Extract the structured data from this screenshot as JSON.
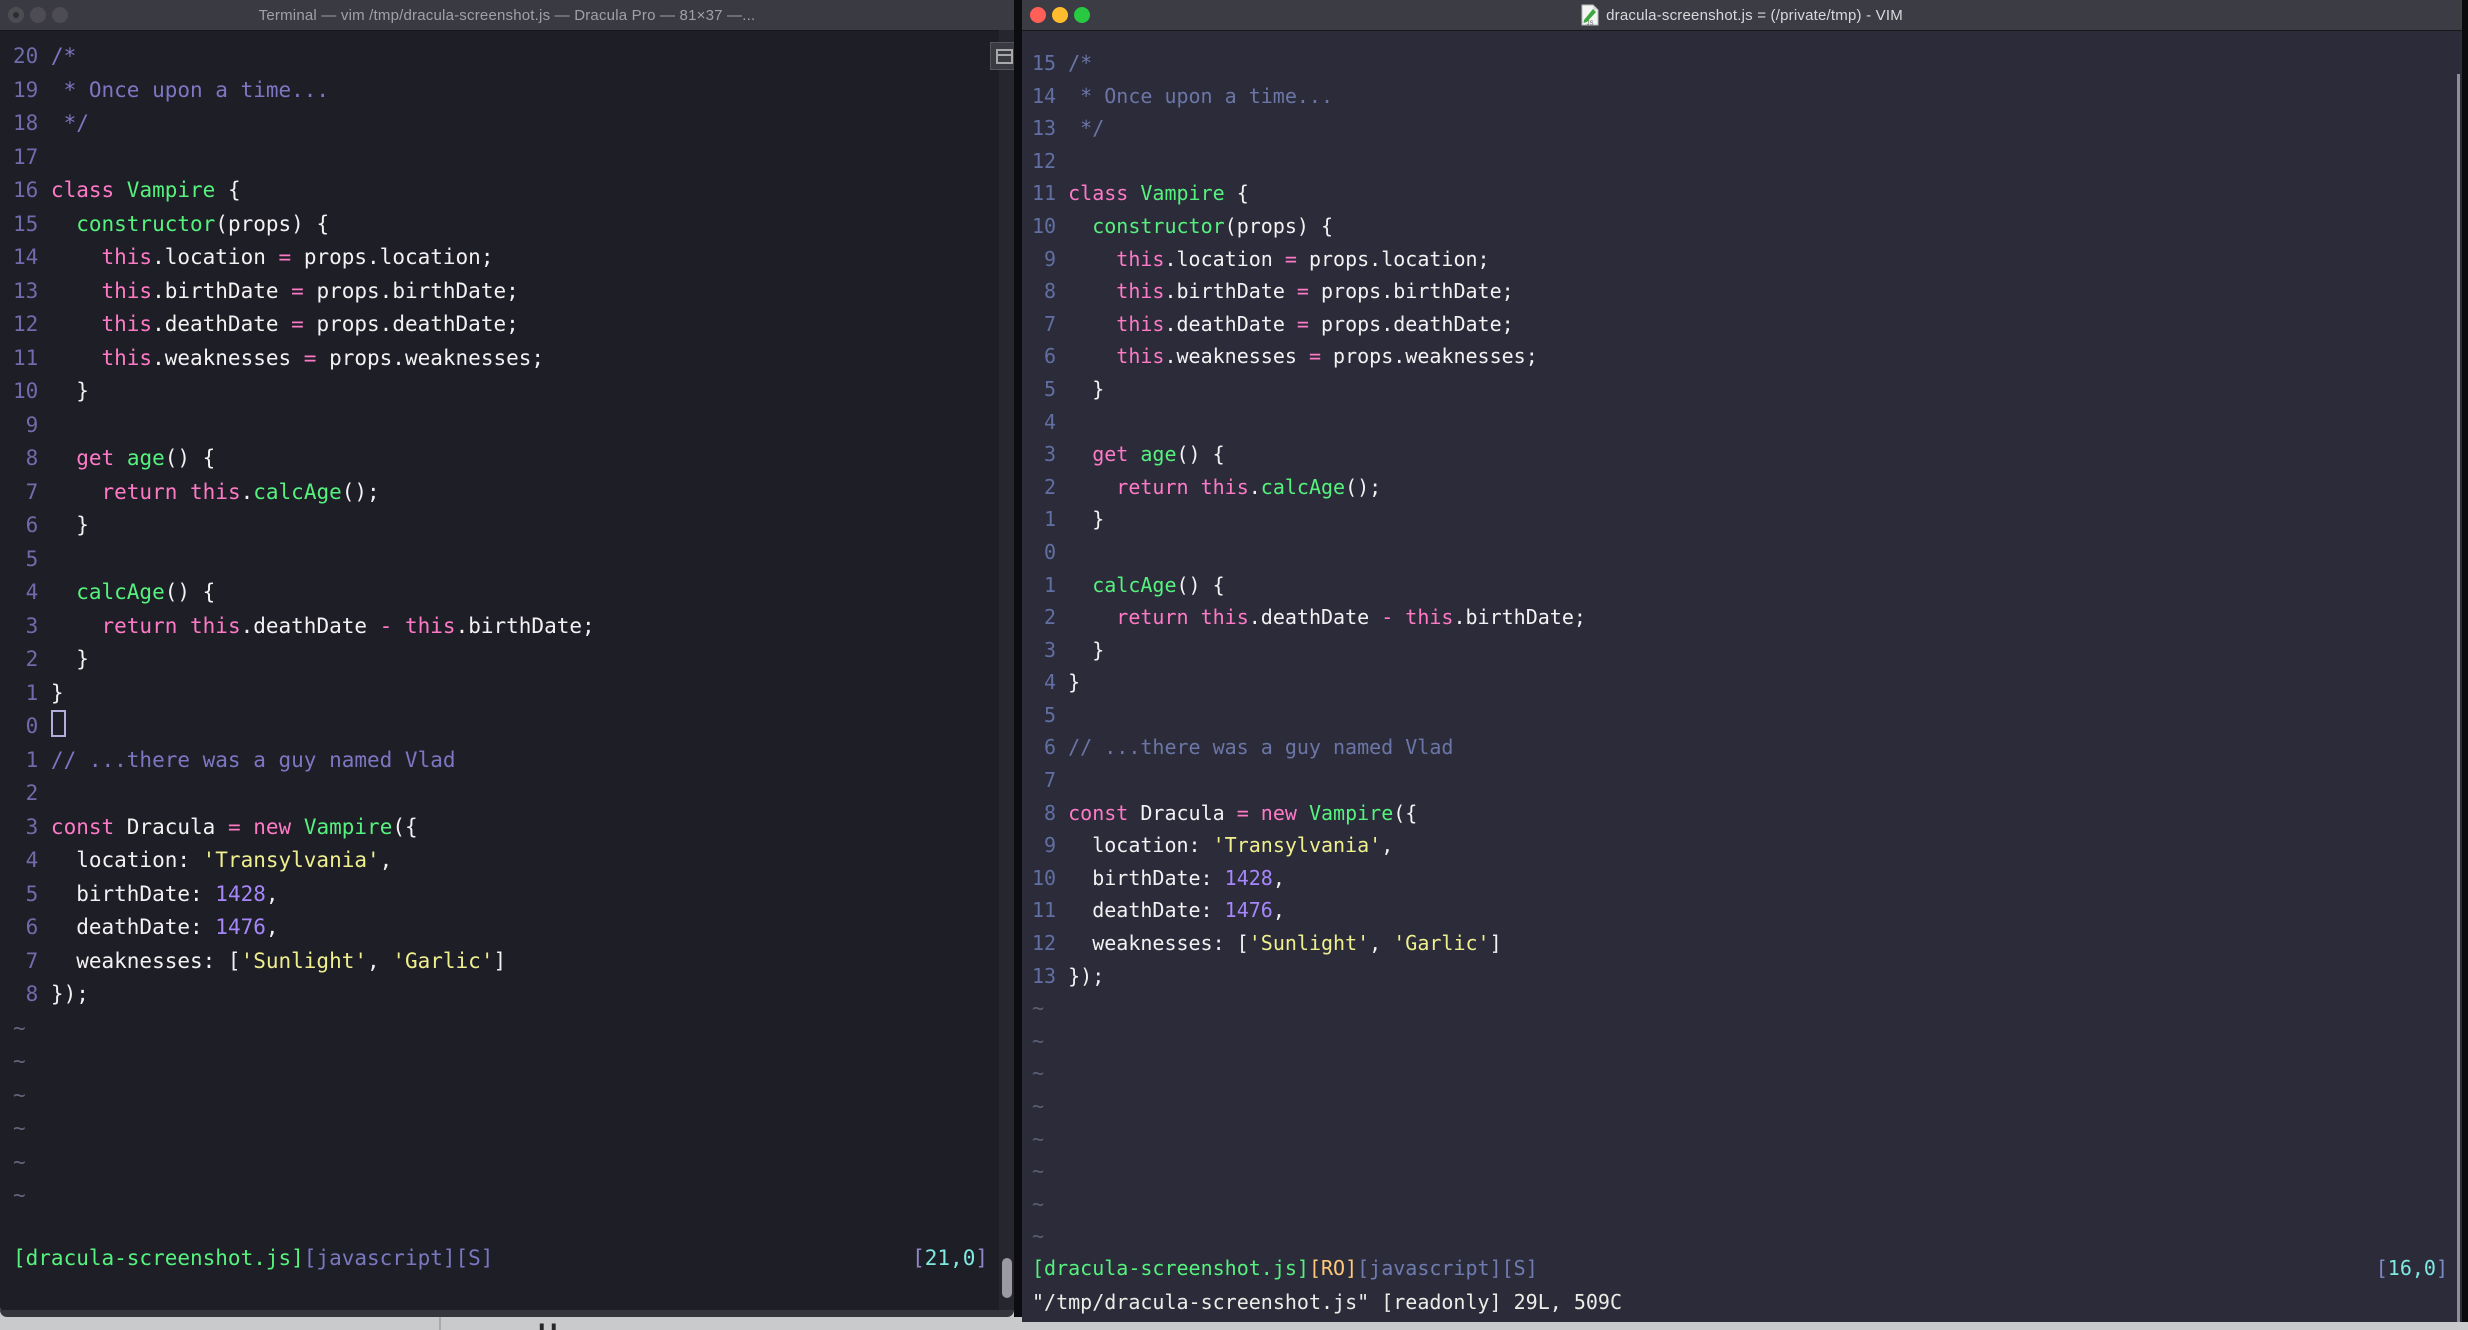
{
  "colors": {
    "left_bg": "#1E1E27",
    "right_bg": "#2B2B3A",
    "titlebar": "#3A3A42",
    "fg": "#F3F1F2",
    "pink": "#FF7AC6",
    "green": "#55F27D",
    "yellow": "#EFF08D",
    "number_literal": "#A687FA",
    "comment_left": "#7E76C2",
    "comment_right": "#6B76A6",
    "lineno_left": "#716BAC",
    "lineno_right": "#626FA2",
    "orange_ro": "#FFC87A",
    "cyan_pos": "#7FE9E2",
    "traffic_red": "#FF5F57",
    "traffic_yellow": "#FEBC2E",
    "traffic_green": "#28C840"
  },
  "file": {
    "lines": [
      [
        [
          "c",
          "/*"
        ]
      ],
      [
        [
          "c",
          " * Once upon a time..."
        ]
      ],
      [
        [
          "c",
          " */"
        ]
      ],
      [
        [
          "w",
          ""
        ]
      ],
      [
        [
          "k",
          "class"
        ],
        [
          "w",
          " "
        ],
        [
          "f",
          "Vampire"
        ],
        [
          "w",
          " {"
        ]
      ],
      [
        [
          "w",
          "  "
        ],
        [
          "f",
          "constructor"
        ],
        [
          "w",
          "(props) {"
        ]
      ],
      [
        [
          "w",
          "    "
        ],
        [
          "k",
          "this"
        ],
        [
          "w",
          ".location "
        ],
        [
          "k",
          "="
        ],
        [
          "w",
          " props.location;"
        ]
      ],
      [
        [
          "w",
          "    "
        ],
        [
          "k",
          "this"
        ],
        [
          "w",
          ".birthDate "
        ],
        [
          "k",
          "="
        ],
        [
          "w",
          " props.birthDate;"
        ]
      ],
      [
        [
          "w",
          "    "
        ],
        [
          "k",
          "this"
        ],
        [
          "w",
          ".deathDate "
        ],
        [
          "k",
          "="
        ],
        [
          "w",
          " props.deathDate;"
        ]
      ],
      [
        [
          "w",
          "    "
        ],
        [
          "k",
          "this"
        ],
        [
          "w",
          ".weaknesses "
        ],
        [
          "k",
          "="
        ],
        [
          "w",
          " props.weaknesses;"
        ]
      ],
      [
        [
          "w",
          "  }"
        ]
      ],
      [
        [
          "w",
          ""
        ]
      ],
      [
        [
          "w",
          "  "
        ],
        [
          "k",
          "get"
        ],
        [
          "w",
          " "
        ],
        [
          "f",
          "age"
        ],
        [
          "w",
          "() {"
        ]
      ],
      [
        [
          "w",
          "    "
        ],
        [
          "k",
          "return"
        ],
        [
          "w",
          " "
        ],
        [
          "k",
          "this"
        ],
        [
          "w",
          "."
        ],
        [
          "f",
          "calcAge"
        ],
        [
          "w",
          "();"
        ]
      ],
      [
        [
          "w",
          "  }"
        ]
      ],
      [
        [
          "w",
          ""
        ]
      ],
      [
        [
          "w",
          "  "
        ],
        [
          "f",
          "calcAge"
        ],
        [
          "w",
          "() {"
        ]
      ],
      [
        [
          "w",
          "    "
        ],
        [
          "k",
          "return"
        ],
        [
          "w",
          " "
        ],
        [
          "k",
          "this"
        ],
        [
          "w",
          ".deathDate "
        ],
        [
          "k",
          "-"
        ],
        [
          "w",
          " "
        ],
        [
          "k",
          "this"
        ],
        [
          "w",
          ".birthDate;"
        ]
      ],
      [
        [
          "w",
          "  }"
        ]
      ],
      [
        [
          "w",
          "}"
        ]
      ],
      [
        [
          "w",
          ""
        ]
      ],
      [
        [
          "c",
          "// ...there was a guy named Vlad"
        ]
      ],
      [
        [
          "w",
          ""
        ]
      ],
      [
        [
          "k",
          "const"
        ],
        [
          "w",
          " Dracula "
        ],
        [
          "k",
          "="
        ],
        [
          "w",
          " "
        ],
        [
          "k",
          "new"
        ],
        [
          "w",
          " "
        ],
        [
          "f",
          "Vampire"
        ],
        [
          "w",
          "({"
        ]
      ],
      [
        [
          "w",
          "  location: "
        ],
        [
          "s",
          "'Transylvania'"
        ],
        [
          "w",
          ","
        ]
      ],
      [
        [
          "w",
          "  birthDate: "
        ],
        [
          "d",
          "1428"
        ],
        [
          "w",
          ","
        ]
      ],
      [
        [
          "w",
          "  deathDate: "
        ],
        [
          "d",
          "1476"
        ],
        [
          "w",
          ","
        ]
      ],
      [
        [
          "w",
          "  weaknesses: ["
        ],
        [
          "s",
          "'Sunlight'"
        ],
        [
          "w",
          ", "
        ],
        [
          "s",
          "'Garlic'"
        ],
        [
          "w",
          "]"
        ]
      ],
      [
        [
          "w",
          "});"
        ]
      ]
    ]
  },
  "left_window": {
    "title": "Terminal — vim /tmp/dracula-screenshot.js — Dracula Pro — 81×37 —...",
    "traffic_lights_state": "inactive",
    "numbers": [
      "20",
      "19",
      "18",
      "17",
      "16",
      "15",
      "14",
      "13",
      "12",
      "11",
      "10",
      "9",
      "8",
      "7",
      "6",
      "5",
      "4",
      "3",
      "2",
      "1",
      "0",
      "1",
      "2",
      "3",
      "4",
      "5",
      "6",
      "7",
      "8"
    ],
    "cursor_line": 21,
    "cursor_visible": true,
    "tilde_count": 6,
    "tilde_char": "~",
    "status_left": [
      [
        "g",
        "[dracula-screenshot.js]"
      ],
      [
        "m",
        "[javascript][S]"
      ]
    ],
    "status_right": [
      [
        "br",
        "["
      ],
      [
        "cy",
        "21,0"
      ],
      [
        "br",
        "]"
      ]
    ]
  },
  "right_window": {
    "title": "dracula-screenshot.js = (/private/tmp) - VIM",
    "traffic_lights_state": "active",
    "numbers": [
      "15",
      "14",
      "13",
      "12",
      "11",
      "10",
      "9",
      "8",
      "7",
      "6",
      "5",
      "4",
      "3",
      "2",
      "1",
      "0",
      "1",
      "2",
      "3",
      "4",
      "5",
      "6",
      "7",
      "8",
      "9",
      "10",
      "11",
      "12",
      "13"
    ],
    "cursor_line": 16,
    "cursor_visible": false,
    "tilde_count": 8,
    "tilde_char": "~",
    "status_left": [
      [
        "g",
        "[dracula-screenshot.js]"
      ],
      [
        "o",
        "[RO]"
      ],
      [
        "m",
        "[javascript][S]"
      ]
    ],
    "status_right": [
      [
        "br",
        "["
      ],
      [
        "cy",
        "16,0"
      ],
      [
        "br",
        "]"
      ]
    ],
    "command_line": "\"/tmp/dracula-screenshot.js\" [readonly] 29L, 509C"
  },
  "desktop": {
    "background_glyph": "H"
  }
}
